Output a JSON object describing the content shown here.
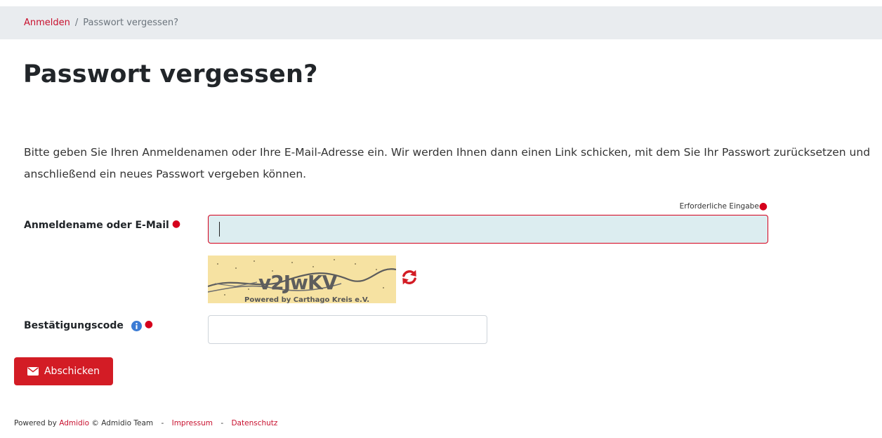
{
  "breadcrumb": {
    "home": "Anmelden",
    "separator": "/",
    "current": "Passwort vergessen?"
  },
  "page_title": "Passwort vergessen?",
  "intro": "Bitte geben Sie Ihren Anmeldenamen oder Ihre E-Mail-Adresse ein. Wir werden Ihnen dann einen Link schicken, mit dem Sie Ihr Passwort zurücksetzen und anschließend ein neues Passwort vergeben können.",
  "required_hint": "Erforderliche Eingabe",
  "form": {
    "username_label": "Anmeldename oder E-Mail",
    "username_value": "",
    "captcha_text": "v2JwKV",
    "captcha_footer": "Powered by Carthago Kreis e.V.",
    "code_label": "Bestätigungscode",
    "code_value": "",
    "submit_label": "Abschicken"
  },
  "footer": {
    "powered_by": "Powered by",
    "app_name": "Admidio",
    "copyright": "© Admidio Team",
    "sep": "-",
    "imprint": "Impressum",
    "privacy": "Datenschutz"
  },
  "colors": {
    "accent": "#d31c25",
    "required": "#d5001c",
    "focus_bg": "#dcedf0",
    "info": "#3b7bd4"
  },
  "icons": {
    "refresh": "refresh-icon",
    "info": "info-icon",
    "submit": "envelope-icon"
  }
}
